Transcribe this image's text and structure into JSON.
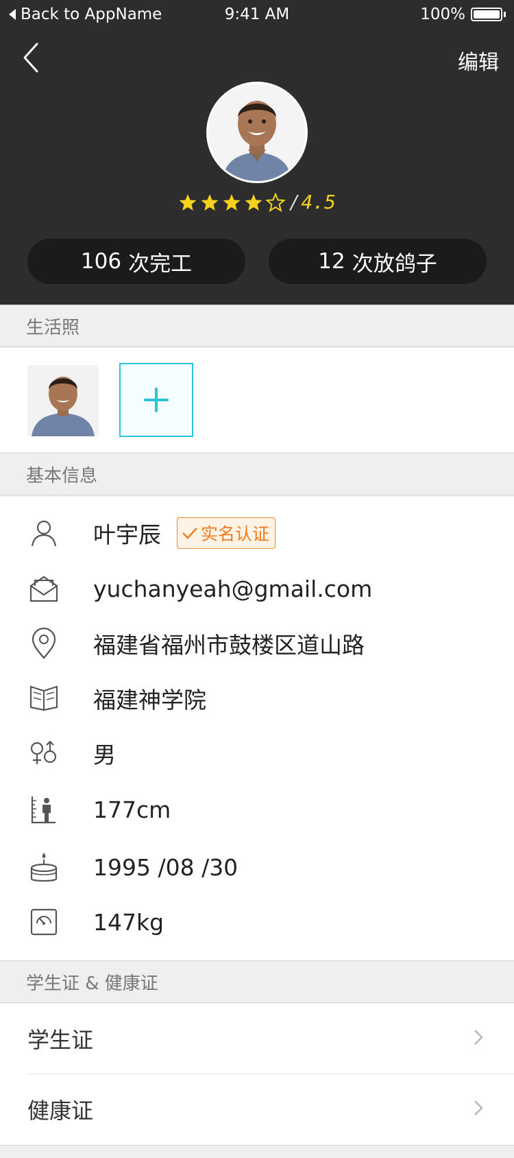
{
  "status_bar": {
    "back_text": "Back to AppName",
    "time": "9:41 AM",
    "battery": "100%"
  },
  "nav": {
    "edit_label": "编辑"
  },
  "profile": {
    "rating_sep": "/",
    "rating_value": "4.5",
    "rating_stars_filled": 4,
    "rating_stars_total": 5,
    "stats": [
      {
        "count": "106",
        "label": "次完工"
      },
      {
        "count": "12",
        "label": "次放鸽子"
      }
    ]
  },
  "sections": {
    "photos_title": "生活照",
    "basic_title": "基本信息",
    "docs_title": "学生证 & 健康证"
  },
  "basic_info": {
    "name": "叶宇辰",
    "verified_label": "实名认证",
    "email": "yuchanyeah@gmail.com",
    "address": "福建省福州市鼓楼区道山路",
    "school": "福建神学院",
    "gender": "男",
    "height": "177cm",
    "birthday": "1995 /08 /30",
    "weight": "147kg"
  },
  "docs": [
    {
      "label": "学生证"
    },
    {
      "label": "健康证"
    }
  ],
  "colors": {
    "header_bg": "#2d2d2d",
    "star": "#f5d21f",
    "accent": "#2bc3d9",
    "badge": "#f07b1a"
  }
}
